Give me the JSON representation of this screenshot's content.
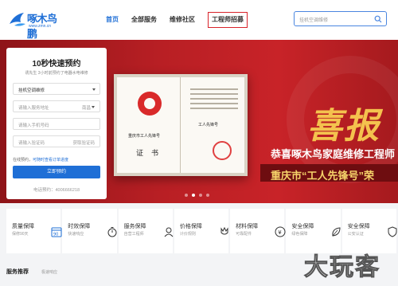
{
  "header": {
    "logo_text": "啄木鸟鹏",
    "logo_sub": "www.zmn.cn",
    "nav": [
      "首页",
      "全部服务",
      "维修社区",
      "工程师招募"
    ],
    "search_placeholder": "挂机空调维修"
  },
  "banner": {
    "cert_caption": "重庆市工人先锋号",
    "cert_word": "证书",
    "cert_right_text": "工人先锋号",
    "headline_char": "喜报",
    "line1": "恭喜啄木鸟家庭维修工程师",
    "line2": "重庆市“工人先锋号”荣",
    "slide_count": 4,
    "active_slide": 2
  },
  "booking": {
    "title": "10秒快速预约",
    "subtitle": "诱先生 3小时前预约了电器水电维修",
    "service_select": "挂机空调维修",
    "address_placeholder": "请输入服务地址",
    "city": "南昌",
    "phone_placeholder": "请输入手机号码",
    "code_placeholder": "请输入验证码",
    "code_button": "获取验证码",
    "note_prefix": "在线预约，",
    "note_link": "可随时查看订单进度",
    "submit": "立即预约",
    "hotline": "电话预约：4006666218"
  },
  "features": [
    {
      "title": "质量保障",
      "sub": "保修90天",
      "icon": "calendar-90-icon"
    },
    {
      "title": "时效保障",
      "sub": "快速响应",
      "icon": "stopwatch-icon"
    },
    {
      "title": "服务保障",
      "sub": "自营工程师",
      "icon": "person-icon"
    },
    {
      "title": "价格保障",
      "sub": "计价规则",
      "icon": "tulip-icon"
    },
    {
      "title": "材料保障",
      "sub": "可靠配件",
      "icon": "yen-circle-icon"
    },
    {
      "title": "安全保障",
      "sub": "绿色保障",
      "icon": "leaf-icon"
    },
    {
      "title": "安全保障",
      "sub": "公安认证",
      "icon": "shield-icon"
    }
  ],
  "recommend": {
    "title": "服务推荐",
    "sub": "极速响应"
  },
  "watermark": "大玩客",
  "colors": {
    "brand_blue": "#1f6fd6",
    "banner_red": "#b81f24",
    "gold": "#f4c24e",
    "nav_box": "#d8232a"
  }
}
